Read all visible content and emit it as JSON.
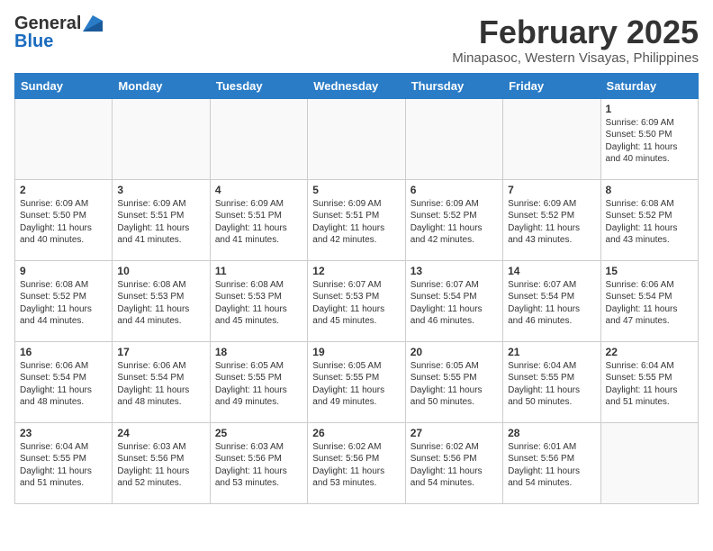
{
  "header": {
    "logo": {
      "general": "General",
      "blue": "Blue"
    },
    "title": "February 2025",
    "subtitle": "Minapasoc, Western Visayas, Philippines"
  },
  "calendar": {
    "days_of_week": [
      "Sunday",
      "Monday",
      "Tuesday",
      "Wednesday",
      "Thursday",
      "Friday",
      "Saturday"
    ],
    "weeks": [
      [
        {
          "day": "",
          "info": ""
        },
        {
          "day": "",
          "info": ""
        },
        {
          "day": "",
          "info": ""
        },
        {
          "day": "",
          "info": ""
        },
        {
          "day": "",
          "info": ""
        },
        {
          "day": "",
          "info": ""
        },
        {
          "day": "1",
          "info": "Sunrise: 6:09 AM\nSunset: 5:50 PM\nDaylight: 11 hours\nand 40 minutes."
        }
      ],
      [
        {
          "day": "2",
          "info": "Sunrise: 6:09 AM\nSunset: 5:50 PM\nDaylight: 11 hours\nand 40 minutes."
        },
        {
          "day": "3",
          "info": "Sunrise: 6:09 AM\nSunset: 5:51 PM\nDaylight: 11 hours\nand 41 minutes."
        },
        {
          "day": "4",
          "info": "Sunrise: 6:09 AM\nSunset: 5:51 PM\nDaylight: 11 hours\nand 41 minutes."
        },
        {
          "day": "5",
          "info": "Sunrise: 6:09 AM\nSunset: 5:51 PM\nDaylight: 11 hours\nand 42 minutes."
        },
        {
          "day": "6",
          "info": "Sunrise: 6:09 AM\nSunset: 5:52 PM\nDaylight: 11 hours\nand 42 minutes."
        },
        {
          "day": "7",
          "info": "Sunrise: 6:09 AM\nSunset: 5:52 PM\nDaylight: 11 hours\nand 43 minutes."
        },
        {
          "day": "8",
          "info": "Sunrise: 6:08 AM\nSunset: 5:52 PM\nDaylight: 11 hours\nand 43 minutes."
        }
      ],
      [
        {
          "day": "9",
          "info": "Sunrise: 6:08 AM\nSunset: 5:52 PM\nDaylight: 11 hours\nand 44 minutes."
        },
        {
          "day": "10",
          "info": "Sunrise: 6:08 AM\nSunset: 5:53 PM\nDaylight: 11 hours\nand 44 minutes."
        },
        {
          "day": "11",
          "info": "Sunrise: 6:08 AM\nSunset: 5:53 PM\nDaylight: 11 hours\nand 45 minutes."
        },
        {
          "day": "12",
          "info": "Sunrise: 6:07 AM\nSunset: 5:53 PM\nDaylight: 11 hours\nand 45 minutes."
        },
        {
          "day": "13",
          "info": "Sunrise: 6:07 AM\nSunset: 5:54 PM\nDaylight: 11 hours\nand 46 minutes."
        },
        {
          "day": "14",
          "info": "Sunrise: 6:07 AM\nSunset: 5:54 PM\nDaylight: 11 hours\nand 46 minutes."
        },
        {
          "day": "15",
          "info": "Sunrise: 6:06 AM\nSunset: 5:54 PM\nDaylight: 11 hours\nand 47 minutes."
        }
      ],
      [
        {
          "day": "16",
          "info": "Sunrise: 6:06 AM\nSunset: 5:54 PM\nDaylight: 11 hours\nand 48 minutes."
        },
        {
          "day": "17",
          "info": "Sunrise: 6:06 AM\nSunset: 5:54 PM\nDaylight: 11 hours\nand 48 minutes."
        },
        {
          "day": "18",
          "info": "Sunrise: 6:05 AM\nSunset: 5:55 PM\nDaylight: 11 hours\nand 49 minutes."
        },
        {
          "day": "19",
          "info": "Sunrise: 6:05 AM\nSunset: 5:55 PM\nDaylight: 11 hours\nand 49 minutes."
        },
        {
          "day": "20",
          "info": "Sunrise: 6:05 AM\nSunset: 5:55 PM\nDaylight: 11 hours\nand 50 minutes."
        },
        {
          "day": "21",
          "info": "Sunrise: 6:04 AM\nSunset: 5:55 PM\nDaylight: 11 hours\nand 50 minutes."
        },
        {
          "day": "22",
          "info": "Sunrise: 6:04 AM\nSunset: 5:55 PM\nDaylight: 11 hours\nand 51 minutes."
        }
      ],
      [
        {
          "day": "23",
          "info": "Sunrise: 6:04 AM\nSunset: 5:55 PM\nDaylight: 11 hours\nand 51 minutes."
        },
        {
          "day": "24",
          "info": "Sunrise: 6:03 AM\nSunset: 5:56 PM\nDaylight: 11 hours\nand 52 minutes."
        },
        {
          "day": "25",
          "info": "Sunrise: 6:03 AM\nSunset: 5:56 PM\nDaylight: 11 hours\nand 53 minutes."
        },
        {
          "day": "26",
          "info": "Sunrise: 6:02 AM\nSunset: 5:56 PM\nDaylight: 11 hours\nand 53 minutes."
        },
        {
          "day": "27",
          "info": "Sunrise: 6:02 AM\nSunset: 5:56 PM\nDaylight: 11 hours\nand 54 minutes."
        },
        {
          "day": "28",
          "info": "Sunrise: 6:01 AM\nSunset: 5:56 PM\nDaylight: 11 hours\nand 54 minutes."
        },
        {
          "day": "",
          "info": ""
        }
      ]
    ]
  }
}
